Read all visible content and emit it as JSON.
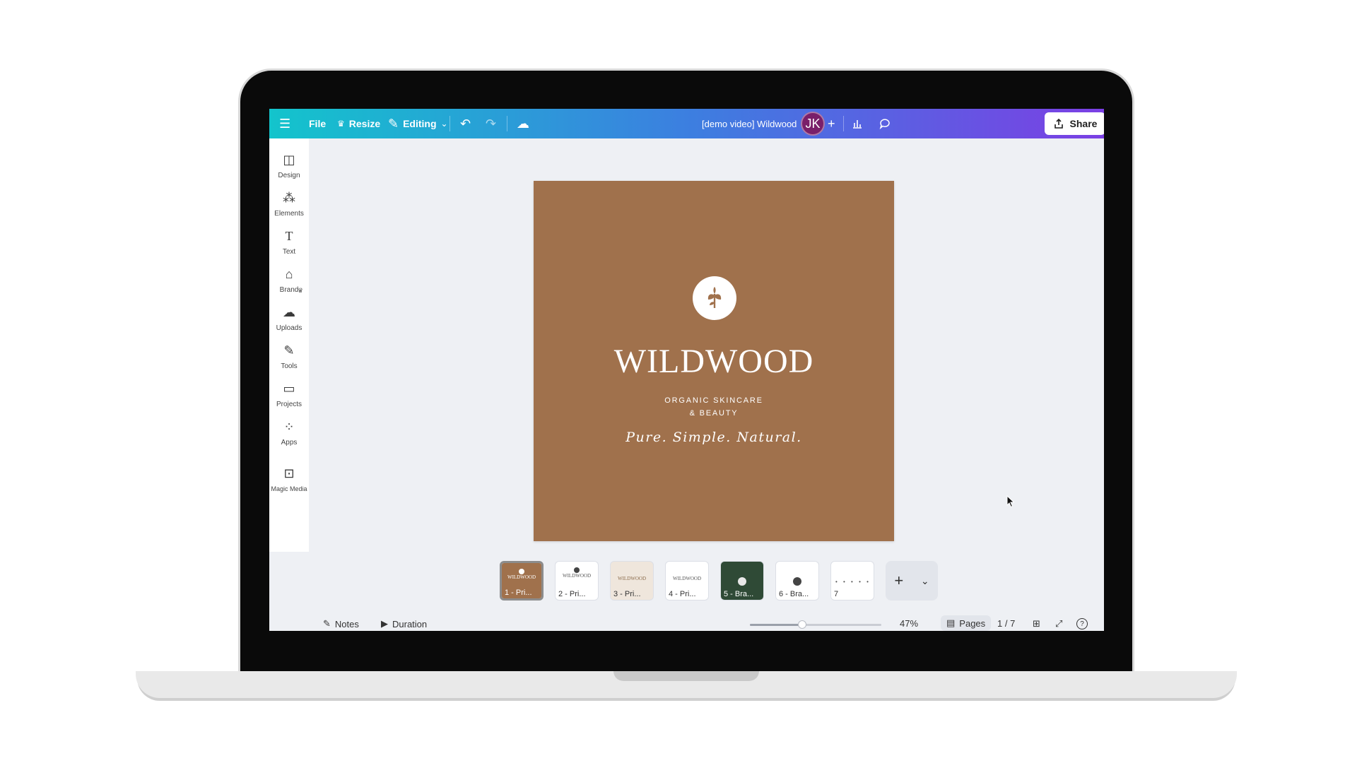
{
  "topbar": {
    "menu_icon": "hamburger-icon",
    "file_label": "File",
    "resize_label": "Resize",
    "editing_label": "Editing",
    "doc_title": "[demo video] Wildwood",
    "avatar_initials": "JK",
    "share_label": "Share",
    "gradient": [
      "#13c4cc",
      "#3c7fe0",
      "#7b3fe4"
    ]
  },
  "sidebar": {
    "items": [
      {
        "label": "Design",
        "icon": "design-icon"
      },
      {
        "label": "Elements",
        "icon": "elements-icon"
      },
      {
        "label": "Text",
        "icon": "text-icon"
      },
      {
        "label": "Brand",
        "icon": "brand-icon"
      },
      {
        "label": "Uploads",
        "icon": "uploads-icon"
      },
      {
        "label": "Tools",
        "icon": "tools-icon"
      },
      {
        "label": "Projects",
        "icon": "projects-icon"
      },
      {
        "label": "Apps",
        "icon": "apps-icon"
      },
      {
        "label": "Magic Media",
        "icon": "magic-media-icon"
      }
    ]
  },
  "canvas": {
    "background": "#a0714c",
    "brand_name": "WILDWOOD",
    "subtitle_line1": "ORGANIC SKINCARE",
    "subtitle_line2": "& BEAUTY",
    "tagline": "Pure. Simple. Natural."
  },
  "pages": {
    "thumbnails": [
      {
        "label": "1 - Pri...",
        "bg": "#a0714c",
        "selected": true
      },
      {
        "label": "2 - Pri...",
        "bg": "#ffffff",
        "selected": false
      },
      {
        "label": "3 - Pri...",
        "bg": "#efe6dc",
        "selected": false
      },
      {
        "label": "4 - Pri...",
        "bg": "#ffffff",
        "selected": false
      },
      {
        "label": "5 - Bra...",
        "bg": "#2f4a36",
        "selected": false
      },
      {
        "label": "6 - Bra...",
        "bg": "#ffffff",
        "selected": false
      },
      {
        "label": "7",
        "bg": "#ffffff",
        "selected": false
      }
    ]
  },
  "footer": {
    "notes_label": "Notes",
    "duration_label": "Duration",
    "zoom": "47%",
    "pages_label": "Pages",
    "page_count": "1 / 7"
  }
}
